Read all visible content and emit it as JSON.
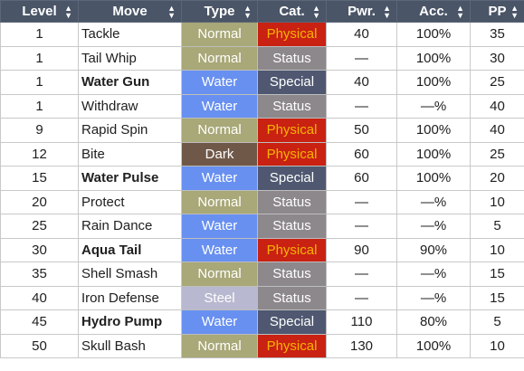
{
  "headers": [
    "Level",
    "Move",
    "Type",
    "Cat.",
    "Pwr.",
    "Acc.",
    "PP"
  ],
  "type_colors": {
    "Normal": "#a8a878",
    "Water": "#6890f0",
    "Dark": "#705848",
    "Steel": "#b8b8d0"
  },
  "category_colors": {
    "Physical": "#c92112",
    "Status": "#8c888c",
    "Special": "#4f5870"
  },
  "category_text_colors": {
    "Physical": "#f4b400",
    "Status": "#ffffff",
    "Special": "#ffffff"
  },
  "rows": [
    {
      "level": "1",
      "move": "Tackle",
      "bold": false,
      "type": "Normal",
      "cat": "Physical",
      "pwr": "40",
      "acc": "100%",
      "pp": "35"
    },
    {
      "level": "1",
      "move": "Tail Whip",
      "bold": false,
      "type": "Normal",
      "cat": "Status",
      "pwr": "—",
      "acc": "100%",
      "pp": "30"
    },
    {
      "level": "1",
      "move": "Water Gun",
      "bold": true,
      "type": "Water",
      "cat": "Special",
      "pwr": "40",
      "acc": "100%",
      "pp": "25"
    },
    {
      "level": "1",
      "move": "Withdraw",
      "bold": false,
      "type": "Water",
      "cat": "Status",
      "pwr": "—",
      "acc": "—%",
      "pp": "40"
    },
    {
      "level": "9",
      "move": "Rapid Spin",
      "bold": false,
      "type": "Normal",
      "cat": "Physical",
      "pwr": "50",
      "acc": "100%",
      "pp": "40"
    },
    {
      "level": "12",
      "move": "Bite",
      "bold": false,
      "type": "Dark",
      "cat": "Physical",
      "pwr": "60",
      "acc": "100%",
      "pp": "25"
    },
    {
      "level": "15",
      "move": "Water Pulse",
      "bold": true,
      "type": "Water",
      "cat": "Special",
      "pwr": "60",
      "acc": "100%",
      "pp": "20"
    },
    {
      "level": "20",
      "move": "Protect",
      "bold": false,
      "type": "Normal",
      "cat": "Status",
      "pwr": "—",
      "acc": "—%",
      "pp": "10"
    },
    {
      "level": "25",
      "move": "Rain Dance",
      "bold": false,
      "type": "Water",
      "cat": "Status",
      "pwr": "—",
      "acc": "—%",
      "pp": "5"
    },
    {
      "level": "30",
      "move": "Aqua Tail",
      "bold": true,
      "type": "Water",
      "cat": "Physical",
      "pwr": "90",
      "acc": "90%",
      "pp": "10"
    },
    {
      "level": "35",
      "move": "Shell Smash",
      "bold": false,
      "type": "Normal",
      "cat": "Status",
      "pwr": "—",
      "acc": "—%",
      "pp": "15"
    },
    {
      "level": "40",
      "move": "Iron Defense",
      "bold": false,
      "type": "Steel",
      "cat": "Status",
      "pwr": "—",
      "acc": "—%",
      "pp": "15"
    },
    {
      "level": "45",
      "move": "Hydro Pump",
      "bold": true,
      "type": "Water",
      "cat": "Special",
      "pwr": "110",
      "acc": "80%",
      "pp": "5"
    },
    {
      "level": "50",
      "move": "Skull Bash",
      "bold": false,
      "type": "Normal",
      "cat": "Physical",
      "pwr": "130",
      "acc": "100%",
      "pp": "10"
    }
  ]
}
